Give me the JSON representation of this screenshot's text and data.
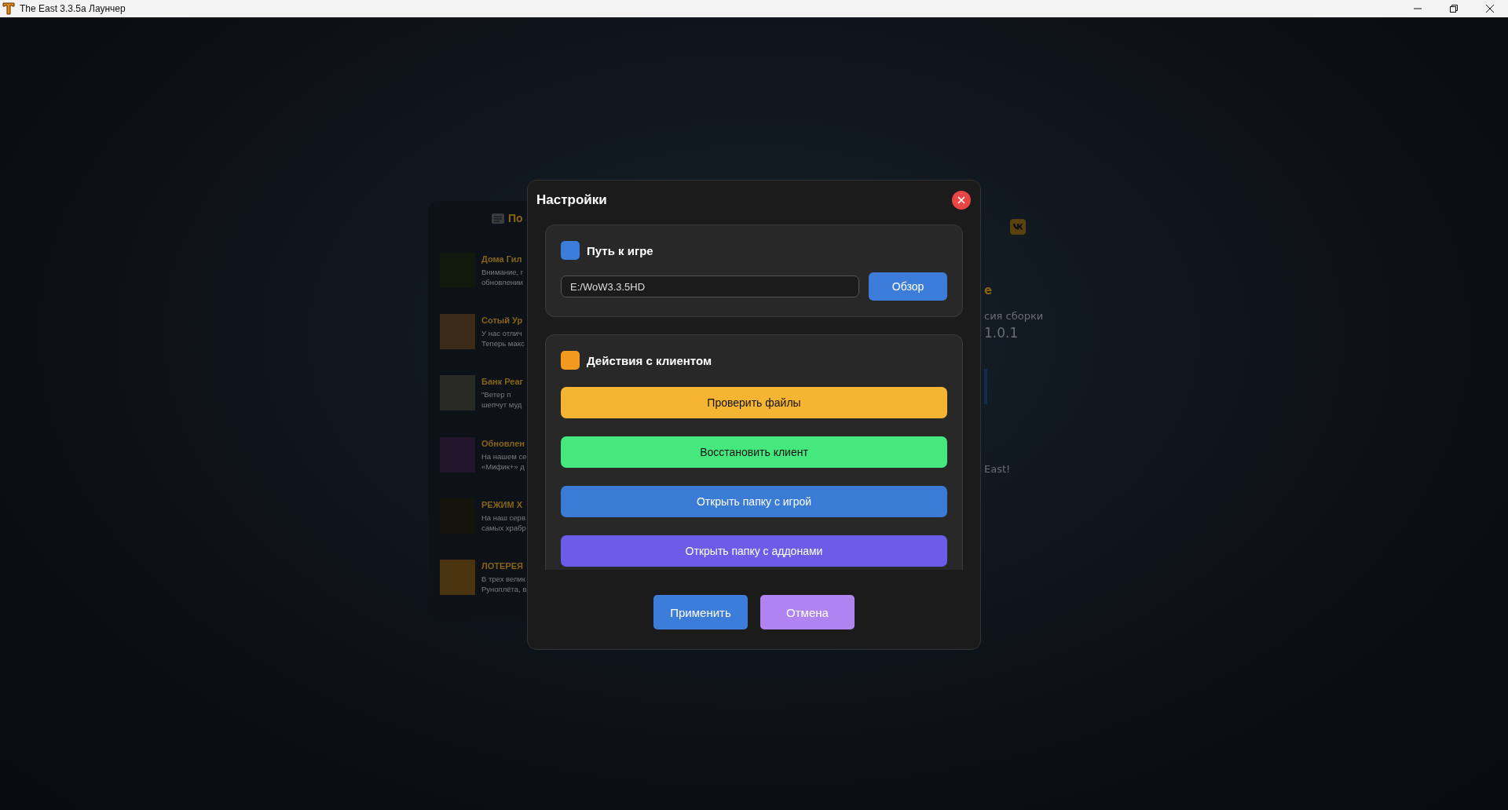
{
  "window": {
    "title": "The East 3.3.5a Лаунчер"
  },
  "news_panel": {
    "title": "По",
    "items": [
      {
        "title": "Дома Гил",
        "lines": [
          "Внимание, г",
          "обновлении"
        ]
      },
      {
        "title": "Сотый Ур",
        "lines": [
          "У нас отлич",
          "Теперь макс"
        ]
      },
      {
        "title": "Банк Реаг",
        "lines": [
          "\"Ветер п",
          "шепчут муд"
        ]
      },
      {
        "title": "Обновлен",
        "lines": [
          "На нашем се",
          "«Мифик+» д"
        ]
      },
      {
        "title": "РЕЖИМ Х",
        "lines": [
          "На наш серв",
          "самых храбр"
        ]
      },
      {
        "title": "ЛОТЕРЕЯ",
        "lines": [
          "В трех велик",
          "Руноплёта, в"
        ]
      }
    ]
  },
  "info_panel": {
    "heading": "е",
    "version_label": "сия сборки",
    "version": "1.0.1",
    "footer": "East!"
  },
  "dialog": {
    "title": "Настройки",
    "path_section": {
      "title": "Путь к игре",
      "color": "#3b7dd8",
      "path_value": "E:/WoW3.3.5HD",
      "browse_button": "Обзор"
    },
    "actions_section": {
      "title": "Действия с клиентом",
      "color": "#f39a1e",
      "actions": [
        {
          "label": "Проверить файлы",
          "color": "#f5b533"
        },
        {
          "label": "Восстановить клиент",
          "color": "#45e87c"
        },
        {
          "label": "Открыть папку с игрой",
          "color": "#3a7bd5"
        },
        {
          "label": "Открыть папку с аддонами",
          "color": "#6c5ce7"
        }
      ]
    },
    "apply_button": "Применить",
    "cancel_button": "Отмена"
  }
}
